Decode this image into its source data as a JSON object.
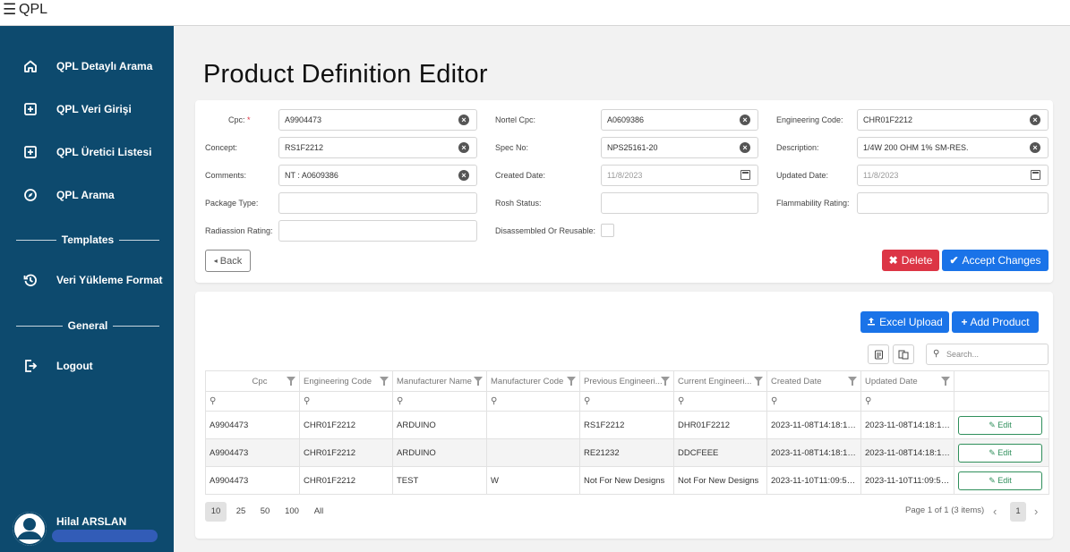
{
  "topbar": {
    "brand": "QPL",
    "menu_icon": "menu-icon"
  },
  "sidebar": {
    "items": [
      {
        "label": "QPL Detaylı Arama",
        "icon": "home-icon"
      },
      {
        "label": "QPL Veri Girişi",
        "icon": "plus-square-icon"
      },
      {
        "label": "QPL Üretici Listesi",
        "icon": "plus-square-icon"
      },
      {
        "label": "QPL Arama",
        "icon": "compass-icon"
      }
    ],
    "section_templates": "Templates",
    "templates_item": {
      "label": "Veri Yükleme Format",
      "icon": "history-icon"
    },
    "section_general": "General",
    "logout": {
      "label": "Logout",
      "icon": "logout-icon"
    },
    "user": {
      "name": "Hilal ARSLAN"
    }
  },
  "page": {
    "title": "Product Definition Editor"
  },
  "form": {
    "cpc": {
      "label": "Cpc:",
      "required": "*",
      "value": "A9904473"
    },
    "nortel_cpc": {
      "label": "Nortel Cpc:",
      "value": "A0609386"
    },
    "engineering_code": {
      "label": "Engineering Code:",
      "value": "CHR01F2212"
    },
    "concept": {
      "label": "Concept:",
      "value": "RS1F2212"
    },
    "spec_no": {
      "label": "Spec No:",
      "value": "NPS25161-20"
    },
    "description": {
      "label": "Description:",
      "value": "1/4W 200 OHM 1% SM-RES."
    },
    "comments": {
      "label": "Comments:",
      "value": "NT : A0609386"
    },
    "created_date": {
      "label": "Created Date:",
      "value": "11/8/2023"
    },
    "updated_date": {
      "label": "Updated Date:",
      "value": "11/8/2023"
    },
    "package_type": {
      "label": "Package Type:",
      "value": ""
    },
    "rosh_status": {
      "label": "Rosh Status:",
      "value": ""
    },
    "flammability": {
      "label": "Flammability Rating:",
      "value": ""
    },
    "radiassion": {
      "label": "Radiassion Rating:",
      "value": ""
    },
    "disassembled": {
      "label": "Disassembled Or Reusable:",
      "checked": false
    },
    "back_label": "Back",
    "delete_label": "Delete",
    "accept_label": "Accept Changes"
  },
  "grid": {
    "excel_upload_label": "Excel Upload",
    "add_product_label": "Add Product",
    "search_placeholder": "Search...",
    "columns": [
      "Cpc",
      "Engineering Code",
      "Manufacturer Name",
      "Manufacturer Code",
      "Previous Engineeri...",
      "Current Engineeri...",
      "Created Date",
      "Updated Date"
    ],
    "rows": [
      [
        "A9904473",
        "CHR01F2212",
        "ARDUINO",
        "",
        "RS1F2212",
        "DHR01F2212",
        "2023-11-08T14:18:12...",
        "2023-11-08T14:18:12..."
      ],
      [
        "A9904473",
        "CHR01F2212",
        "ARDUINO",
        "",
        "RE21232",
        "DDCFEEE",
        "2023-11-08T14:18:12...",
        "2023-11-08T14:18:12..."
      ],
      [
        "A9904473",
        "CHR01F2212",
        "TEST",
        "W",
        "Not For New Designs",
        "Not For New Designs",
        "2023-11-10T11:09:55...",
        "2023-11-10T11:09:55..."
      ]
    ],
    "edit_label": "Edit",
    "page_sizes": [
      "10",
      "25",
      "50",
      "100",
      "All"
    ],
    "selected_page_size": "10",
    "page_info": "Page 1 of 1 (3 items)",
    "current_page": "1"
  }
}
